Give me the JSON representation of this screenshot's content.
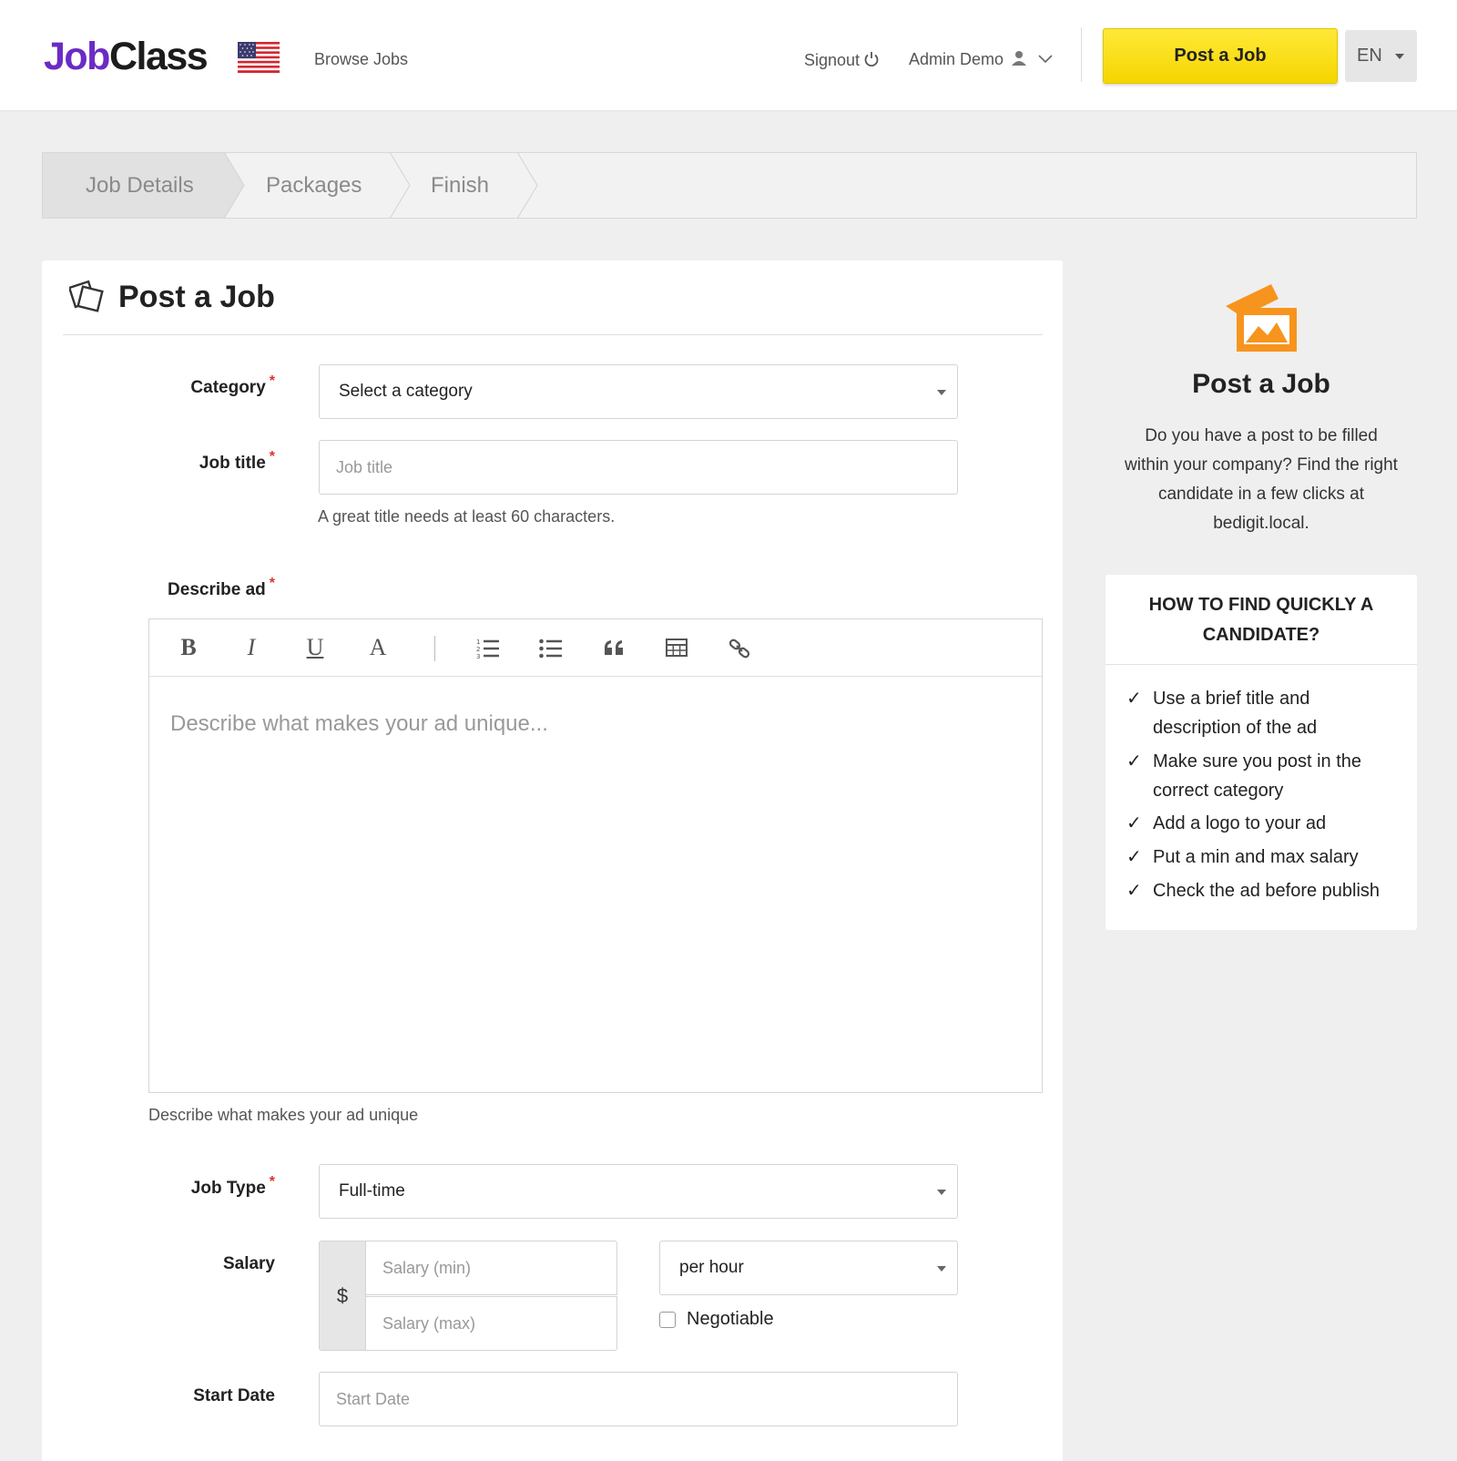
{
  "header": {
    "logo_part1": "Job",
    "logo_part2": "Class",
    "browse_jobs": "Browse Jobs",
    "signout": "Signout",
    "user_name": "Admin Demo",
    "post_job_button": "Post a Job",
    "language": "EN",
    "brand_color": "#6b2bc4",
    "button_color": "#f5d500"
  },
  "steps": [
    {
      "label": "Job Details",
      "active": true
    },
    {
      "label": "Packages",
      "active": false
    },
    {
      "label": "Finish",
      "active": false
    }
  ],
  "form": {
    "title": "Post a Job",
    "category": {
      "label": "Category",
      "value": "Select a category"
    },
    "job_title": {
      "label": "Job title",
      "placeholder": "Job title",
      "help": "A great title needs at least 60 characters."
    },
    "description": {
      "label": "Describe ad",
      "placeholder": "Describe what makes your ad unique...",
      "help": "Describe what makes your ad unique",
      "toolbar": [
        "bold",
        "italic",
        "underline",
        "font-color",
        "ordered-list",
        "unordered-list",
        "quote",
        "table",
        "link"
      ]
    },
    "job_type": {
      "label": "Job Type",
      "value": "Full-time"
    },
    "salary": {
      "label": "Salary",
      "currency": "$",
      "min_placeholder": "Salary (min)",
      "max_placeholder": "Salary (max)",
      "period": "per hour",
      "negotiable_label": "Negotiable",
      "negotiable_checked": false
    },
    "start_date": {
      "label": "Start Date",
      "placeholder": "Start Date"
    },
    "required_marker": "*"
  },
  "sidebar": {
    "title": "Post a Job",
    "text": "Do you have a post to be filled within your company? Find the right candidate in a few clicks at bedigit.local.",
    "icon_color": "#f7941d",
    "tips_heading": "HOW TO FIND QUICKLY A CANDIDATE?",
    "check": "✓",
    "tips": [
      "Use a brief title and description of the ad",
      "Make sure you post in the correct category",
      "Add a logo to your ad",
      "Put a min and max salary",
      "Check the ad before publish"
    ]
  }
}
